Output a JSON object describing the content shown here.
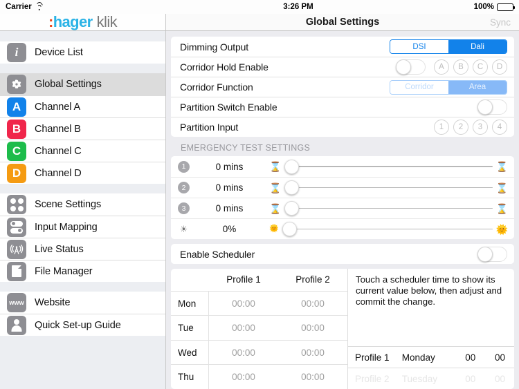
{
  "statusbar": {
    "carrier": "Carrier",
    "time": "3:26 PM",
    "battery": "100%"
  },
  "navbar": {
    "brand_colon": ":",
    "brand_hager": "hager",
    "brand_klik": "klik",
    "title": "Global Settings",
    "sync": "Sync"
  },
  "sidebar": {
    "group1": [
      {
        "label": "Device List",
        "icon": "info-icon"
      }
    ],
    "group2": [
      {
        "label": "Global Settings",
        "icon": "gear-icon",
        "selected": true
      },
      {
        "label": "Channel A",
        "icon": "letter-a-icon",
        "color": "#1282ea"
      },
      {
        "label": "Channel B",
        "icon": "letter-b-icon",
        "color": "#f0264b"
      },
      {
        "label": "Channel C",
        "icon": "letter-c-icon",
        "color": "#1dbc4b"
      },
      {
        "label": "Channel D",
        "icon": "letter-d-icon",
        "color": "#f59b12"
      }
    ],
    "group3": [
      {
        "label": "Scene Settings",
        "icon": "four-dots-icon"
      },
      {
        "label": "Input Mapping",
        "icon": "toggles-icon"
      },
      {
        "label": "Live Status",
        "icon": "broadcast-tower-icon"
      },
      {
        "label": "File Manager",
        "icon": "document-icon"
      }
    ],
    "group4": [
      {
        "label": "Website",
        "icon": "www-icon"
      },
      {
        "label": "Quick Set-up Guide",
        "icon": "person-icon"
      }
    ]
  },
  "settings": {
    "rows": [
      {
        "label": "Dimming Output",
        "type": "segmented",
        "options": [
          "DSI",
          "Dali"
        ],
        "selected": "Dali",
        "disabled": false
      },
      {
        "label": "Corridor Hold Enable",
        "type": "switch-circles",
        "switch_on": false,
        "circles": [
          "A",
          "B",
          "C",
          "D"
        ]
      },
      {
        "label": "Corridor Function",
        "type": "segmented",
        "options": [
          "Corridor",
          "Area"
        ],
        "selected": "Area",
        "disabled": true
      },
      {
        "label": "Partition Switch Enable",
        "type": "switch",
        "switch_on": false
      },
      {
        "label": "Partition Input",
        "type": "circles",
        "circles": [
          "1",
          "2",
          "3",
          "4"
        ]
      }
    ]
  },
  "emergency": {
    "header": "EMERGENCY TEST SETTINGS",
    "rows": [
      {
        "badge": "1",
        "badge_type": "number",
        "value": "0 mins",
        "left_icon": "hourglass-icon",
        "right_icon": "hourglass-icon",
        "slider_pct": 0
      },
      {
        "badge": "2",
        "badge_type": "number",
        "value": "0 mins",
        "left_icon": "hourglass-icon",
        "right_icon": "hourglass-icon",
        "slider_pct": 0
      },
      {
        "badge": "3",
        "badge_type": "number",
        "value": "0 mins",
        "left_icon": "hourglass-icon",
        "right_icon": "hourglass-icon",
        "slider_pct": 0
      },
      {
        "badge": "☀",
        "badge_type": "sun",
        "value": "0%",
        "left_icon": "sun-small-icon",
        "right_icon": "sun-large-icon",
        "slider_pct": 0
      }
    ]
  },
  "scheduler": {
    "enable_label": "Enable Scheduler",
    "enable_on": false,
    "columns": [
      "",
      "Profile 1",
      "Profile 2"
    ],
    "rows": [
      {
        "day": "Mon",
        "p1": "00:00",
        "p2": "00:00"
      },
      {
        "day": "Tue",
        "p1": "00:00",
        "p2": "00:00"
      },
      {
        "day": "Wed",
        "p1": "00:00",
        "p2": "00:00"
      },
      {
        "day": "Thu",
        "p1": "00:00",
        "p2": "00:00"
      }
    ],
    "hint": "Touch a scheduler time to show its current value below, then adjust and commit the change.",
    "picker": {
      "profile": "Profile 1",
      "day": "Monday",
      "hour": "00",
      "minute": "00"
    },
    "picker_next": {
      "profile": "Profile 2",
      "day": "Tuesday",
      "hour": "00",
      "minute": "00"
    }
  }
}
